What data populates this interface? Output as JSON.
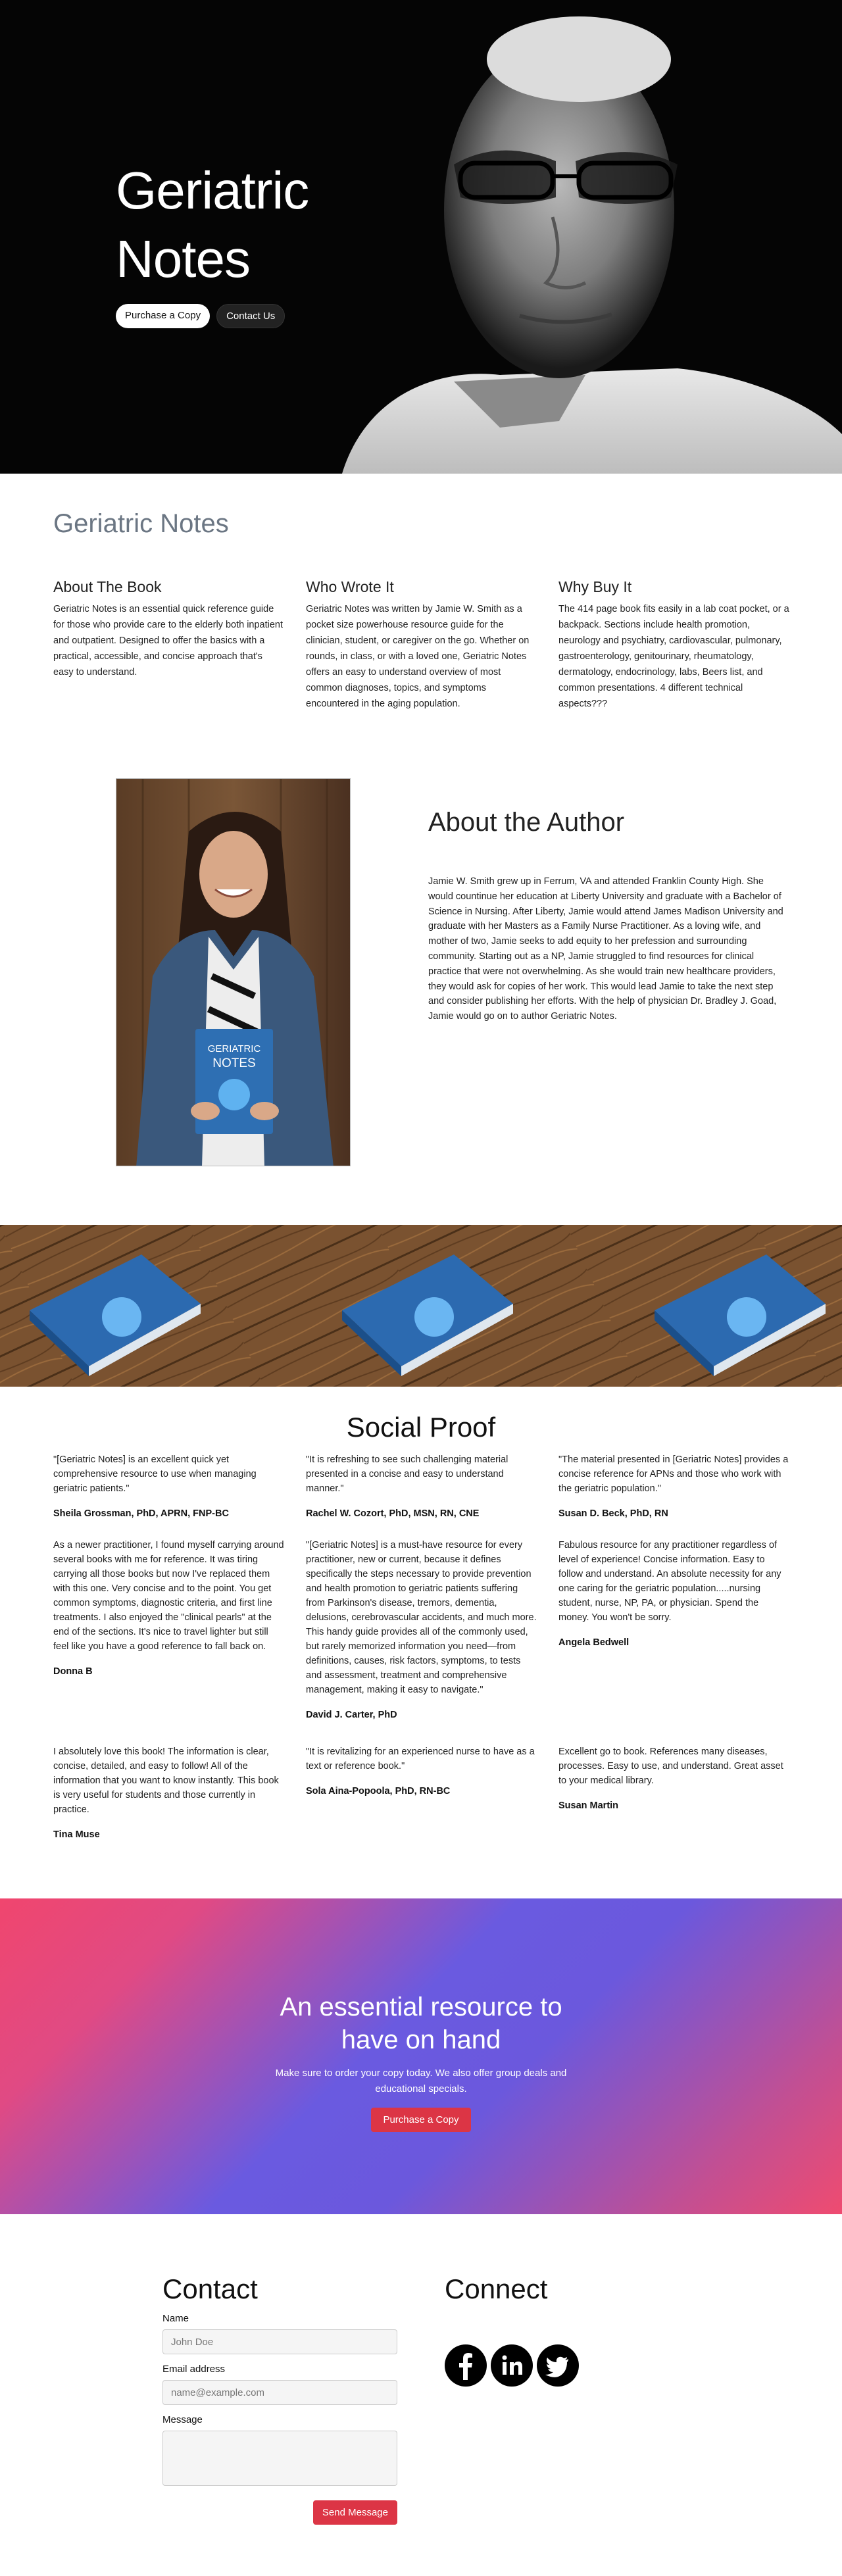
{
  "hero": {
    "title": "Geriatric Notes",
    "buttons": [
      "Purchase a Copy",
      "Contact Us"
    ]
  },
  "intro": {
    "title": "Geriatric Notes",
    "columns": [
      {
        "heading": "About The Book",
        "text": "Geriatric Notes is an essential quick reference guide for those who provide care to the elderly both inpatient and outpatient. Designed to offer the basics with a practical, accessible, and concise approach that's easy to understand."
      },
      {
        "heading": "Who Wrote It",
        "text": "Geriatric Notes was written by Jamie W. Smith as a pocket size powerhouse resource guide for the clinician, student, or caregiver on the go. Whether on rounds, in class, or with a loved one, Geriatric Notes offers an easy to understand overview of most common diagnoses, topics, and symptoms encountered in the aging population."
      },
      {
        "heading": "Why Buy It",
        "text": "The 414 page book fits easily in a lab coat pocket, or a backpack. Sections include health promotion, neurology and psychiatry, cardiovascular, pulmonary, gastroenterology, genitourinary, rheumatology, dermatology, endocrinology, labs, Beers list, and common presentations. 4 different technical aspects???"
      }
    ]
  },
  "author": {
    "title": "About the Author",
    "bio": "Jamie W. Smith grew up in Ferrum, VA and attended Franklin County High. She would countinue her education at Liberty University and graduate with a Bachelor of Science in Nursing. After Liberty, Jamie would attend James Madison University and graduate with her Masters as a Family Nurse Practitioner. As a loving wife, and mother of two, Jamie seeks to add equity to her prefession and surrounding community. Starting out as a NP, Jamie struggled to find resources for clinical practice that were not overwhelming. As she would train new healthcare providers, they would ask for copies of her work. This would lead Jamie to take the next step and consider publishing her efforts. With the help of physician Dr. Bradley J. Goad, Jamie would go on to author Geriatric Notes.",
    "book_cover_title": [
      "GERIATRIC",
      "NOTES"
    ]
  },
  "social": {
    "title": "Social Proof",
    "columns": [
      [
        {
          "quote": "\"[Geriatric Notes] is an excellent quick yet comprehensive resource to use when managing geriatric patients.\"",
          "name": "Sheila Grossman, PhD, APRN, FNP-BC"
        },
        {
          "quote": "As a newer practitioner, I found myself carrying around several books with me for reference. It was tiring carrying all those books but now I've replaced them with this one. Very concise and to the point. You get common symptoms, diagnostic criteria, and first line treatments. I also enjoyed the \"clinical pearls\" at the end of the sections. It's nice to travel lighter but still feel like you have a good reference to fall back on.",
          "name": "Donna B"
        }
      ],
      [
        {
          "quote": "\"It is refreshing to see such challenging material presented in a concise and easy to understand manner.\"",
          "name": "Rachel W. Cozort, PhD, MSN, RN, CNE"
        },
        {
          "quote": "\"[Geriatric Notes] is a must-have resource for every practitioner, new or current, because it defines specifically the steps necessary to provide prevention and health promotion to geriatric patients suffering from Parkinson's disease, tremors, dementia, delusions, cerebrovascular accidents, and much more. This handy guide provides all of the commonly used, but rarely memorized information you need—from definitions, causes, risk factors, symptoms, to tests and assessment, treatment and comprehensive management, making it easy to navigate.\"",
          "name": "David J. Carter, PhD"
        }
      ],
      [
        {
          "quote": "\"The material presented in [Geriatric Notes] provides a concise reference for APNs and those who work with the geriatric population.\"",
          "name": "Susan D. Beck, PhD, RN"
        },
        {
          "quote": "Fabulous resource for any practitioner regardless of level of experience! Concise information. Easy to follow and understand. An absolute necessity for any one caring for the geriatric population.....nursing student, nurse, NP, PA, or physician. Spend the money. You won't be sorry.",
          "name": "Angela Bedwell"
        }
      ]
    ],
    "row2": [
      {
        "quote": "I absolutely love this book! The information is clear, concise, detailed, and easy to follow! All of the information that you want to know instantly. This book is very useful for students and those currently in practice.",
        "name": "Tina Muse"
      },
      {
        "quote": "\"It is revitalizing for an experienced nurse to have as a text or reference book.\"",
        "name": "Sola Aina-Popoola, PhD, RN-BC"
      },
      {
        "quote": "Excellent go to book. References many diseases, processes. Easy to use, and understand. Great asset to your medical library.",
        "name": "Susan Martin"
      }
    ]
  },
  "cta": {
    "title": "An essential resource to have on hand",
    "text": "Make sure to order your copy today. We also offer group deals and educational specials.",
    "button": "Purchase a Copy"
  },
  "contact": {
    "title": "Contact",
    "name_label": "Name",
    "name_placeholder": "John Doe",
    "email_label": "Email address",
    "email_placeholder": "name@example.com",
    "message_label": "Message",
    "send": "Send Message"
  },
  "connect": {
    "title": "Connect",
    "icons": [
      "facebook-icon",
      "linkedin-icon",
      "twitter-icon"
    ]
  },
  "colors": {
    "accent": "#dc3545",
    "heading_gray": "#6b7683",
    "gradient": [
      "#f0466e",
      "#6a5ae0",
      "#ef4b70"
    ]
  }
}
